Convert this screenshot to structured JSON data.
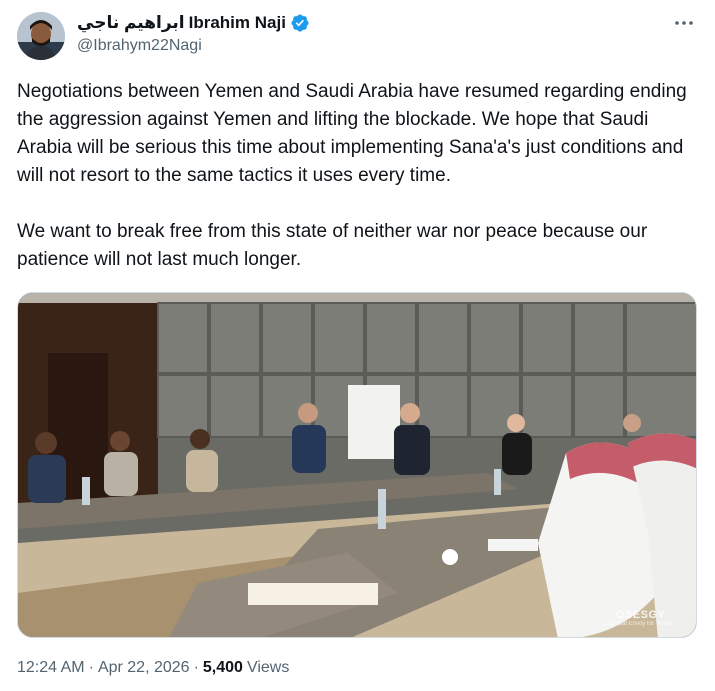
{
  "author": {
    "arabic_name": "ابراهيم ناجي",
    "name": "Ibrahim Naji",
    "handle": "@Ibrahym22Nagi",
    "verified": true,
    "avatar": "profile-photo"
  },
  "more_menu": {
    "icon": "more-dots-icon"
  },
  "tweet": {
    "paragraphs": [
      "Negotiations between Yemen and Saudi Arabia have resumed regarding ending the aggression against Yemen and lifting the blockade. We hope that Saudi Arabia will be serious this time about implementing Sana'a's just conditions and will not resort to the same tactics it uses every time.",
      "We want to break free from this state of neither war nor peace because our patience will not last much longer."
    ]
  },
  "media": {
    "type": "photo",
    "content": "conference-room-meeting",
    "watermark_main": "OSESGY",
    "watermark_sub": "Special Envoy for Yemen"
  },
  "meta": {
    "time": "12:24 AM",
    "separator": "·",
    "date": "Apr 22, 2026",
    "views_count": "5,400",
    "views_label": "Views"
  },
  "colors": {
    "verified_blue": "#1d9bf0",
    "secondary_text": "#536471",
    "primary_text": "#0f1419"
  }
}
